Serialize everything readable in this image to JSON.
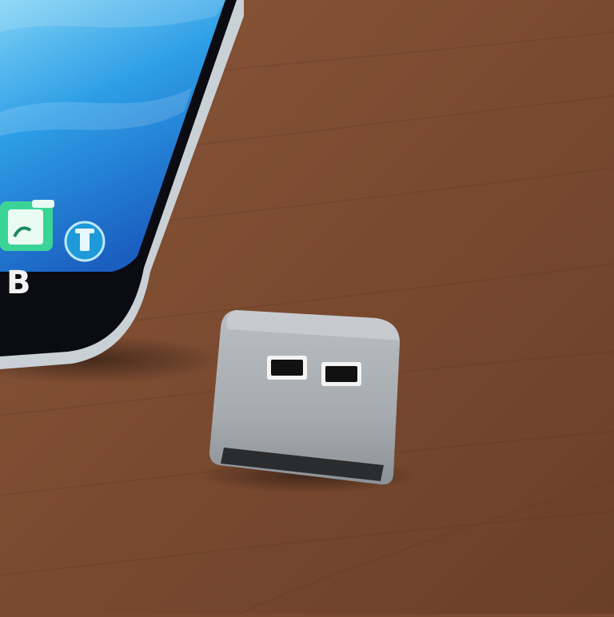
{
  "scene": {
    "table": {
      "kind": "wooden surface",
      "color": "#7a4a30"
    },
    "phone": {
      "screen_glyph": "B",
      "app_icons": [
        "clipboard-app-icon",
        "circle-app-icon"
      ],
      "colors": {
        "screen_light": "#7fd2f5",
        "screen_mid": "#2d9ee6",
        "screen_dark": "#1a5fc0",
        "bezel": "#0b0b12",
        "frame": "#c9d0d6"
      }
    },
    "adapter": {
      "kind": "usb hub adapter",
      "port_count": 2,
      "colors": {
        "body": "#a9aeb2",
        "body_shadow": "#7e8387",
        "port": "#111111"
      }
    }
  }
}
